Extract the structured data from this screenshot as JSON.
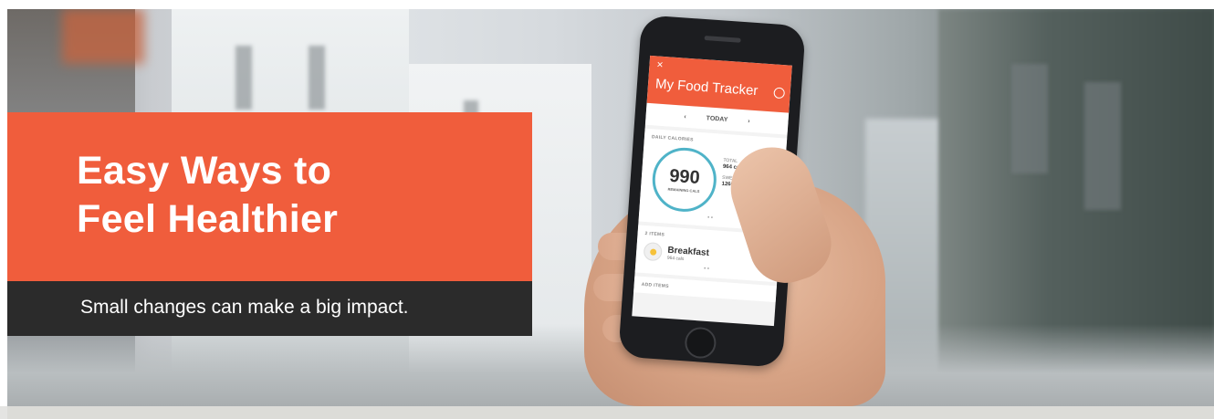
{
  "hero": {
    "title_line1": "Easy Ways to",
    "title_line2": "Feel Healthier",
    "subtitle": "Small changes can make a big impact."
  },
  "phone_app": {
    "close_icon": "×",
    "title": "My Food Tracker",
    "menu_icon": "ellipsis-circle-icon",
    "date_prev": "‹",
    "date_label": "TODAY",
    "date_next": "›",
    "daily_calories_label": "DAILY CALORIES",
    "remaining_value": "990",
    "remaining_label": "REMAINING CALS",
    "total_label": "TOTAL",
    "total_value": "964 cals",
    "sweet_spot_label": "SWEET SPOT",
    "sweet_spot_value": "1260 cals",
    "items_count_label": "2 ITEMS",
    "meal_name": "Breakfast",
    "meal_cals": "964 cals",
    "add_items_label": "ADD ITEMS",
    "pager_dots": "• •"
  },
  "colors": {
    "accent": "#f05d3c",
    "dark_band": "#2b2b2b",
    "ring": "#4fb3c8"
  }
}
